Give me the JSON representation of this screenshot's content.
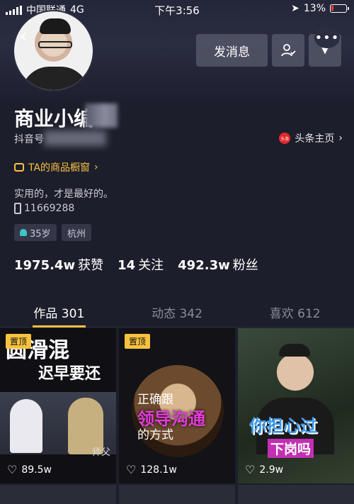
{
  "status_bar": {
    "carrier": "中国联通",
    "network": "4G",
    "time": "下午3:56",
    "battery": "13%"
  },
  "header": {
    "message_button": "发消息",
    "username": "商业小编",
    "douyin_id_label": "抖音号",
    "toutiao_link": "头条主页",
    "toutiao_badge": "头条"
  },
  "profile": {
    "shop_link": "TA的商品橱窗",
    "motto": "实用的，才是最好的。",
    "phone": "11669288",
    "tags": [
      "35岁",
      "杭州"
    ]
  },
  "stats": {
    "likes_value": "1975.4w",
    "likes_label": "获赞",
    "following_value": "14",
    "following_label": "关注",
    "followers_value": "492.3w",
    "followers_label": "粉丝"
  },
  "tabs": [
    {
      "label": "作品 301",
      "active": true
    },
    {
      "label": "动态 342",
      "active": false
    },
    {
      "label": "喜欢 612",
      "active": false
    }
  ],
  "videos": [
    {
      "pinned_label": "置顶",
      "title_line1": "圆滑混",
      "title_line2": "迟早要还",
      "caption": "师父",
      "likes": "89.5w"
    },
    {
      "pinned_label": "置顶",
      "title_line1": "正确跟",
      "title_line2": "领导沟通",
      "title_line3": "的方式",
      "likes": "128.1w"
    },
    {
      "title_line1": "你担心过",
      "title_line2": "下岗吗",
      "likes": "2.9w"
    }
  ],
  "colors": {
    "accent": "#f7c23f",
    "background": "#1d1e2b",
    "toutiao_red": "#e6282a"
  }
}
